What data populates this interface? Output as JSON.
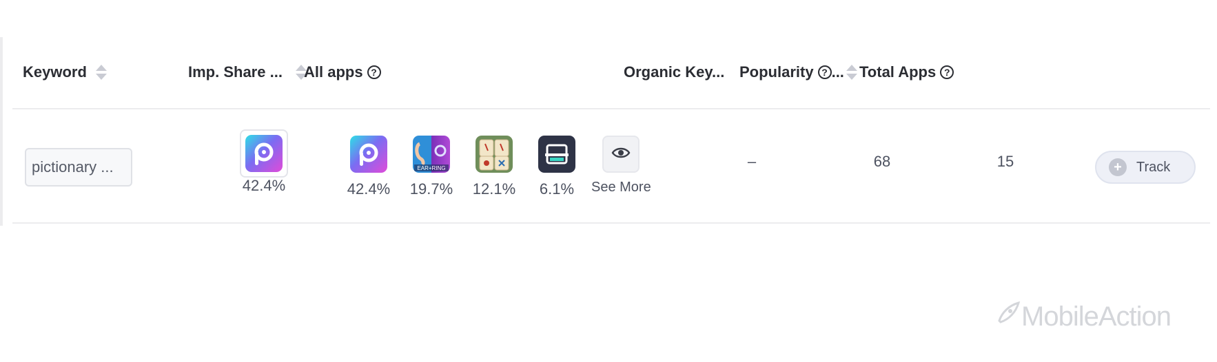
{
  "table": {
    "columns": {
      "keyword": "Keyword",
      "imp_share": "Imp. Share ...",
      "all_apps": "All apps",
      "organic": "Organic Key...",
      "popularity": "Popularity",
      "popularity_ellipsis": "...",
      "total_apps": "Total Apps"
    },
    "row": {
      "keyword": "pictionary ...",
      "imp_share_app": {
        "icon": "picsart-icon",
        "percent": "42.4%"
      },
      "all_apps": [
        {
          "icon": "picsart-icon",
          "percent": "42.4%"
        },
        {
          "icon": "ear-ring-icon",
          "percent": "19.7%"
        },
        {
          "icon": "mahjong-icon",
          "percent": "12.1%"
        },
        {
          "icon": "scanner-icon",
          "percent": "6.1%"
        }
      ],
      "see_more": "See More",
      "organic": "–",
      "popularity": "68",
      "total_apps": "15",
      "track": "Track"
    }
  },
  "watermark": "MobileAction",
  "colors": {
    "border": "#ececee",
    "text": "#2b2d33",
    "muted_text": "#4d5260",
    "track_bg": "#eef0f7"
  }
}
